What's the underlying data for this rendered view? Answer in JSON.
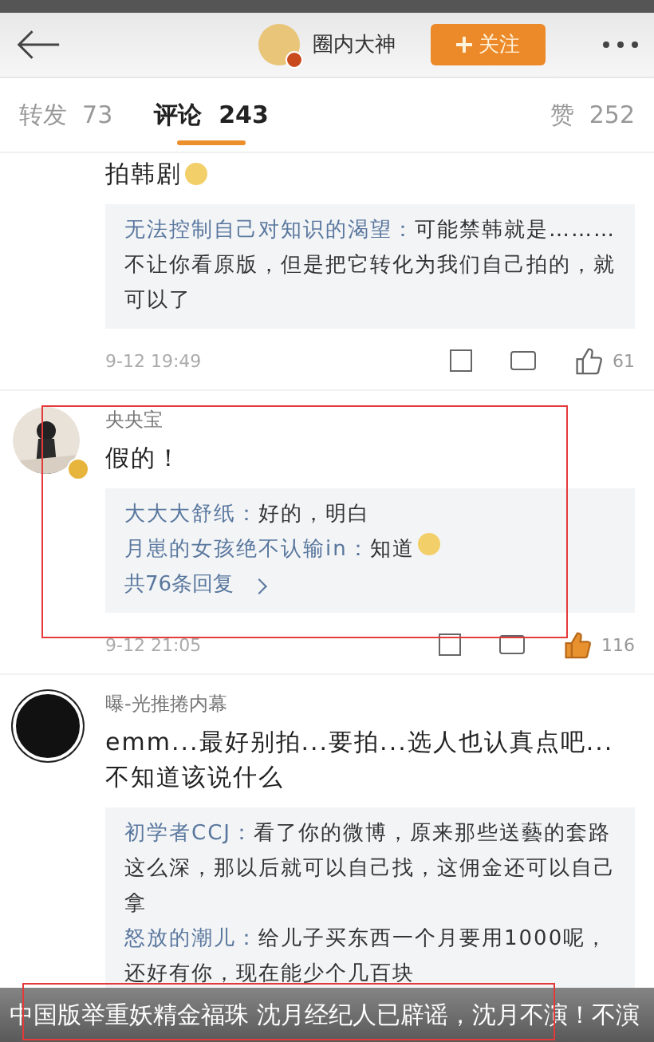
{
  "header": {
    "name": "圈内大神",
    "verified": true,
    "follow": "关注"
  },
  "tabs": [
    {
      "label": "转发",
      "count": "73",
      "selected": false
    },
    {
      "label": "评论",
      "count": "243",
      "selected": true
    },
    {
      "label": "赞",
      "count": "252",
      "selected": false
    }
  ],
  "comments": [
    {
      "kind": "tail",
      "text": "拍韩剧",
      "emoji": true,
      "replies": [
        {
          "user": "无法控制自己对知识的渴望：",
          "text": "可能禁韩就是………不让你看原版，但是把它转化为我们自己拍的，就可以了",
          "emoji": false
        }
      ],
      "time": "9-12 19:49",
      "likes": "61",
      "liked": false
    },
    {
      "user": "央央宝",
      "verified": true,
      "text": "假的！",
      "emoji": false,
      "replies": [
        {
          "user": "大大大舒纸：",
          "text": "好的，明白",
          "emoji": false
        },
        {
          "user": "月崽的女孩绝不认输in：",
          "text": "知道",
          "emoji": true
        }
      ],
      "more": "共76条回复",
      "time": "9-12 21:05",
      "likes": "116",
      "liked": true
    },
    {
      "kind": "logo",
      "user": "曝-光推捲内幕",
      "text": "emm...最好别拍...要拍...选人也认真点吧...不知道该说什么",
      "emoji": false,
      "replies": [
        {
          "user": "初学者CCJ：",
          "text": "看了你的微博，原来那些送藝的套路这么深，那以后就可以自己找，这佣金还可以自己拿",
          "emoji": false
        },
        {
          "user": "怒放的潮儿：",
          "text": "给儿子买东西一个月要用1000呢，还好有你，现在能少个几百块",
          "emoji": false
        }
      ]
    }
  ],
  "caption": "中国版举重妖精金福珠  沈月经纪人已辟谣，沈月不演！不演"
}
